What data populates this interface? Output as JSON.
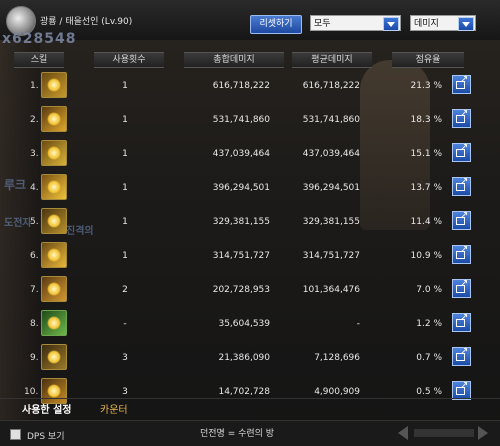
{
  "header": {
    "character": "광룡 / 태을선인 (Lv.90)",
    "big_number": "x628548",
    "reset_label": "리셋하기",
    "filter_value": "모두",
    "metric_value": "데미지"
  },
  "columns": {
    "skill": "스킬",
    "count": "사용횟수",
    "total": "총합데미지",
    "avg": "평균데미지",
    "share": "점유율"
  },
  "rows": [
    {
      "rank": "1.",
      "count": "1",
      "total": "616,718,222",
      "avg": "616,718,222",
      "share": "21.3 %"
    },
    {
      "rank": "2.",
      "count": "1",
      "total": "531,741,860",
      "avg": "531,741,860",
      "share": "18.3 %"
    },
    {
      "rank": "3.",
      "count": "1",
      "total": "437,039,464",
      "avg": "437,039,464",
      "share": "15.1 %"
    },
    {
      "rank": "4.",
      "count": "1",
      "total": "396,294,501",
      "avg": "396,294,501",
      "share": "13.7 %"
    },
    {
      "rank": "5.",
      "count": "1",
      "total": "329,381,155",
      "avg": "329,381,155",
      "share": "11.4 %"
    },
    {
      "rank": "6.",
      "count": "1",
      "total": "314,751,727",
      "avg": "314,751,727",
      "share": "10.9 %"
    },
    {
      "rank": "7.",
      "count": "2",
      "total": "202,728,953",
      "avg": "101,364,476",
      "share": "7.0 %"
    },
    {
      "rank": "8.",
      "count": "-",
      "total": "35,604,539",
      "avg": "-",
      "share": "1.2 %"
    },
    {
      "rank": "9.",
      "count": "3",
      "total": "21,386,090",
      "avg": "7,128,696",
      "share": "0.7 %"
    },
    {
      "rank": "10.",
      "count": "3",
      "total": "14,702,728",
      "avg": "4,900,909",
      "share": "0.5 %"
    }
  ],
  "tabs": {
    "usage": "사용한 설정",
    "counter": "카운터"
  },
  "footer": {
    "dps_label": "DPS 보기",
    "dungeon": "던전명 = 수련의 방"
  },
  "background_text": {
    "t1": "루크",
    "t2": "도전자",
    "t3": "진격의"
  }
}
